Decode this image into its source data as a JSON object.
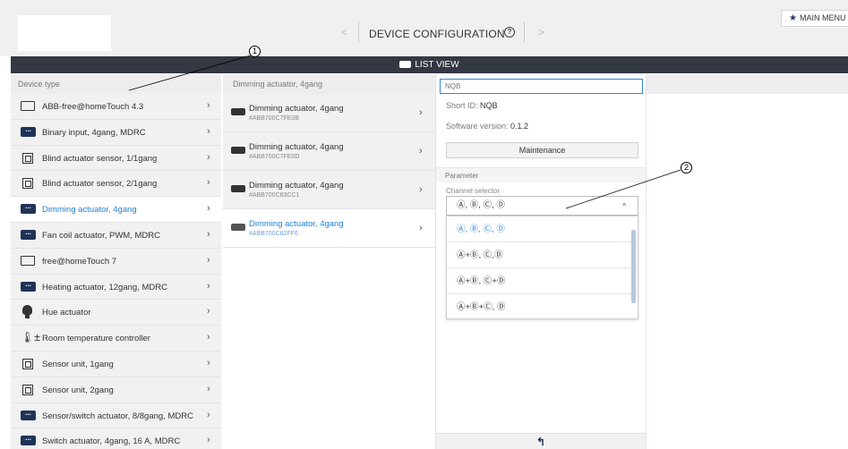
{
  "header": {
    "title": "DEVICE CONFIGURATION",
    "prev_glyph": "<",
    "next_glyph": ">",
    "help_glyph": "?",
    "main_menu_label": "MAIN MENU",
    "main_menu_icon": "star-icon"
  },
  "listbar": {
    "label": "LIST VIEW"
  },
  "device_column": {
    "header": "Device type",
    "items": [
      {
        "label": "ABB-free@homeTouch 4.3",
        "icon": "panel-icon"
      },
      {
        "label": "Binary input, 4gang, MDRC",
        "icon": "dots-icon"
      },
      {
        "label": "Blind actuator sensor, 1/1gang",
        "icon": "square-icon"
      },
      {
        "label": "Blind actuator sensor, 2/1gang",
        "icon": "square-icon"
      },
      {
        "label": "Dimming actuator, 4gang",
        "icon": "dots-icon",
        "selected": true
      },
      {
        "label": "Fan coil actuator, PWM, MDRC",
        "icon": "dots-icon"
      },
      {
        "label": "free@homeTouch 7",
        "icon": "panel-icon"
      },
      {
        "label": "Heating actuator, 12gang, MDRC",
        "icon": "dots-icon"
      },
      {
        "label": "Hue actuator",
        "icon": "bulb-icon"
      },
      {
        "label": "Room temperature controller",
        "icon": "thermometer-icon"
      },
      {
        "label": "Sensor unit, 1gang",
        "icon": "square-icon"
      },
      {
        "label": "Sensor unit, 2gang",
        "icon": "square-icon"
      },
      {
        "label": "Sensor/switch actuator, 8/8gang, MDRC",
        "icon": "dots-icon"
      },
      {
        "label": "Switch actuator, 4gang, 16 A, MDRC",
        "icon": "dots-icon"
      }
    ]
  },
  "channel_column": {
    "header": "Dimming actuator, 4gang",
    "items": [
      {
        "name": "Dimming actuator, 4gang",
        "id": "#ABB700C7FE0B"
      },
      {
        "name": "Dimming actuator, 4gang",
        "id": "#ABB700C7FE0D"
      },
      {
        "name": "Dimming actuator, 4gang",
        "id": "#ABB700C83CC1"
      },
      {
        "name": "Dimming actuator, 4gang",
        "id": "#ABB700C82FF6",
        "selected": true
      }
    ]
  },
  "detail": {
    "name_placeholder": "NQB",
    "short_id_label": "Short ID:",
    "short_id_value": "NQB",
    "software_label": "Software version:",
    "software_value": "0.1.2",
    "maintenance_label": "Maintenance",
    "parameter_label": "Parameter",
    "channel_selector_label": "Channel selector",
    "channel_selector_value": "Ⓐ, Ⓑ, Ⓒ, Ⓓ",
    "caret": "^",
    "options": [
      "Ⓐ, Ⓑ, Ⓒ, Ⓓ",
      "Ⓐ+Ⓑ, Ⓒ,Ⓓ",
      "Ⓐ+Ⓑ, Ⓒ+Ⓓ",
      "Ⓐ+Ⓑ+Ⓒ, Ⓓ"
    ],
    "back_icon": "back-arrow-icon"
  },
  "callouts": [
    "1",
    "2"
  ]
}
